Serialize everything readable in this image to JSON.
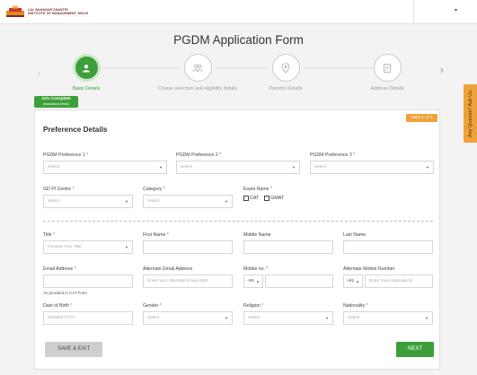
{
  "header": {
    "logo_line1": "LAL BAHADUR SHASTRI",
    "logo_line2": "INSTITUTE OF MANAGEMENT, DELHI",
    "user_menu_caret": "▾"
  },
  "page_title": "PGDM Application Form",
  "steps": [
    {
      "label": "Basic Details",
      "icon": "user-icon",
      "active": true
    },
    {
      "label": "Course selection and eligibility details",
      "icon": "people-icon",
      "active": false
    },
    {
      "label": "Parent's Details",
      "icon": "location-pin-icon",
      "active": false
    },
    {
      "label": "Address Details",
      "icon": "document-icon",
      "active": false
    }
  ],
  "progress": {
    "text": "11% Complete",
    "sub": "(mandatory fields)",
    "value_percent": 11
  },
  "step_badge": "Step 1 of 7",
  "section_title": "Preference Details",
  "side_tab": "Any Queries? Ask Us",
  "form": {
    "pref1": {
      "label": "PGDM Preference 1",
      "value": "Select"
    },
    "pref2": {
      "label": "PGDM Preference 2",
      "value": "Select"
    },
    "pref3": {
      "label": "PGDM Preference 3",
      "value": "Select"
    },
    "gdpi": {
      "label": "GD PI Centre",
      "value": "Select"
    },
    "category": {
      "label": "Category",
      "value": "Select"
    },
    "exam": {
      "label": "Exam Name",
      "options": [
        "CAT",
        "GMAT"
      ]
    },
    "title": {
      "label": "Title",
      "value": "Choose Your Title"
    },
    "first_name": {
      "label": "First Name",
      "value": ""
    },
    "middle_name": {
      "label": "Middle Name",
      "value": ""
    },
    "last_name": {
      "label": "Last Name",
      "value": ""
    },
    "email": {
      "label": "Email Address",
      "value": "",
      "note": "As provided in CAT Form"
    },
    "alt_email": {
      "label": "Alternate Email Address",
      "placeholder": "Enter Your Alternate Email Addr"
    },
    "mobile": {
      "label": "Mobile no.",
      "code": "+91"
    },
    "alt_mobile": {
      "label": "Alternate Mobile Number",
      "code": "+91",
      "placeholder": "Enter Your Alternate M"
    },
    "dob": {
      "label": "Date of Birth",
      "placeholder": "DD/MM/YYYY"
    },
    "gender": {
      "label": "Gender",
      "value": "Select"
    },
    "religion": {
      "label": "Religion",
      "value": "Select"
    },
    "nationality": {
      "label": "Nationality",
      "value": "Select"
    }
  },
  "buttons": {
    "save_exit": "SAVE & EXIT",
    "next": "NEXT"
  },
  "colors": {
    "green": "#3d9f3a",
    "orange": "#f0a23a"
  }
}
